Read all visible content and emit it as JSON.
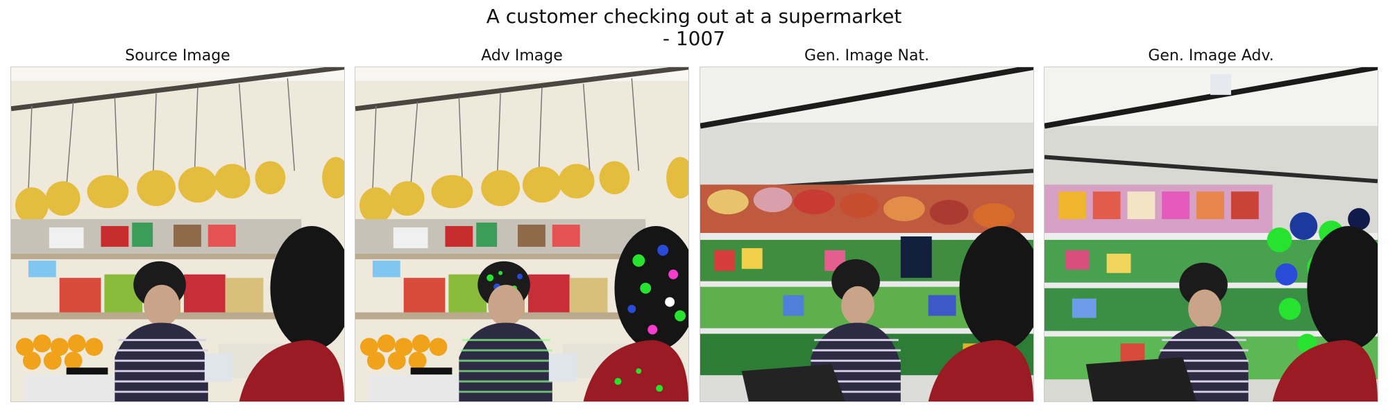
{
  "figure": {
    "title_line1": "A customer checking out at a supermarket",
    "title_line2": "- 1007"
  },
  "panels": [
    {
      "label": "Source Image"
    },
    {
      "label": "Adv Image"
    },
    {
      "label": "Gen. Image Nat."
    },
    {
      "label": "Gen. Image Adv."
    }
  ],
  "colors": {
    "banana": "#e8c34a",
    "wall": "#f2efe6",
    "shelf_red": "#c8322b",
    "shelf_green": "#5aa83c",
    "adv_noise_green": "#27e22f",
    "adv_noise_blue": "#2a4bd8",
    "hair": "#1b1b1b",
    "stripes": "#2d2a44"
  }
}
